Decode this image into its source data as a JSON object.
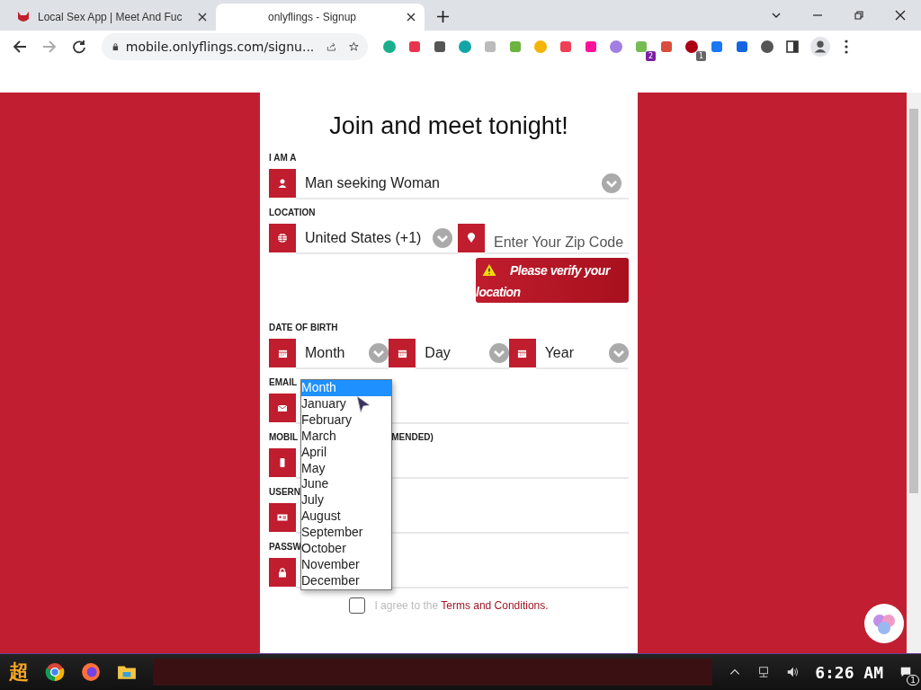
{
  "browser": {
    "tabs": [
      {
        "title": "Local Sex App | Meet And Fuc",
        "selected": false
      },
      {
        "title": "onlyflings - Signup",
        "selected": true
      }
    ],
    "address": "mobile.onlyflings.com/signu...",
    "extension_badges": [
      "2",
      "1"
    ]
  },
  "form": {
    "title": "Join and meet tonight!",
    "i_am_a": {
      "label": "I AM A",
      "value": "Man seeking Woman"
    },
    "location": {
      "label": "LOCATION",
      "country": "United States (+1)",
      "zip_placeholder": "Enter Your Zip Code",
      "error": "Please verify your location"
    },
    "date_of_birth": {
      "label": "DATE OF BIRTH",
      "month": "Month",
      "day": "Day",
      "year": "Year"
    },
    "inputs": [
      {
        "kind": "email",
        "label_parts": [
          "EMAIL"
        ]
      },
      {
        "kind": "mobile",
        "label_parts": [
          "MOBIL",
          "MENDED)"
        ]
      },
      {
        "kind": "username",
        "label_parts": [
          "USERN"
        ]
      },
      {
        "kind": "password",
        "label_parts": [
          "PASSW"
        ]
      }
    ],
    "terms": {
      "checked": false,
      "text": "I agree to the",
      "link": "Terms and Conditions."
    }
  },
  "month_dropdown": {
    "options": [
      {
        "label": "Month",
        "selected": true
      },
      {
        "label": "January",
        "selected": false
      },
      {
        "label": "February",
        "selected": false
      },
      {
        "label": "March",
        "selected": false
      },
      {
        "label": "April",
        "selected": false
      },
      {
        "label": "May",
        "selected": false
      },
      {
        "label": "June",
        "selected": false
      },
      {
        "label": "July",
        "selected": false
      },
      {
        "label": "August",
        "selected": false
      },
      {
        "label": "September",
        "selected": false
      },
      {
        "label": "October",
        "selected": false
      },
      {
        "label": "November",
        "selected": false
      },
      {
        "label": "December",
        "selected": false
      }
    ]
  },
  "taskbar": {
    "start_label": "超",
    "time": "6:26 AM",
    "notification_count": "1"
  }
}
